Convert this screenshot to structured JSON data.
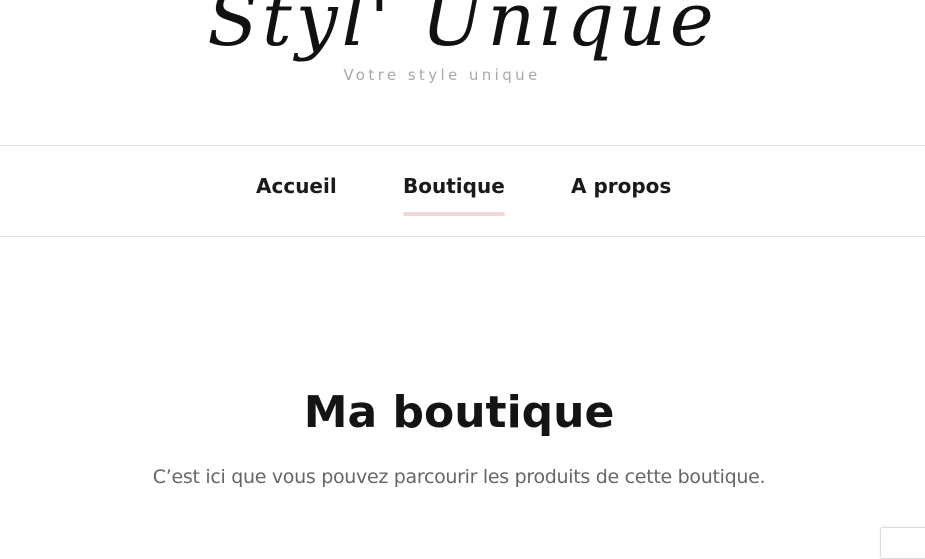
{
  "header": {
    "logo_text": "Styl' Unique",
    "tagline": "Votre style unique"
  },
  "nav": {
    "items": [
      {
        "label": "Accueil",
        "active": false
      },
      {
        "label": "Boutique",
        "active": true
      },
      {
        "label": "A propos",
        "active": false
      }
    ],
    "active_underline_color": "#f0d8d8"
  },
  "main": {
    "title": "Ma boutique",
    "subtitle": "C’est ici que vous pouvez parcourir les produits de cette boutique."
  },
  "colors": {
    "tagline": "#a9a9a9",
    "subtitle": "#666666",
    "divider": "#e3e3e3"
  }
}
